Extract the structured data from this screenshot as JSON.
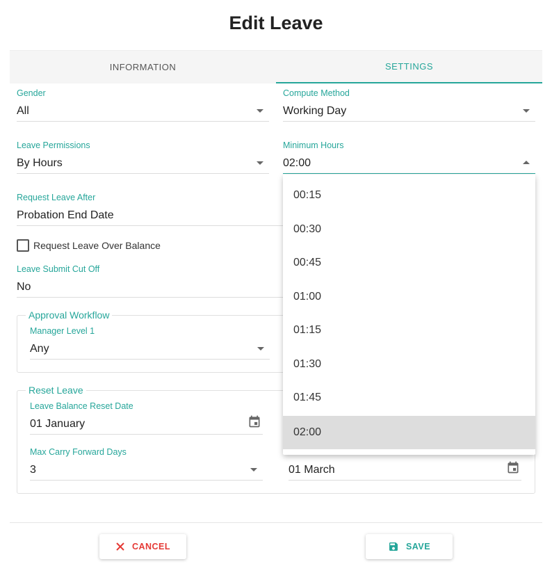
{
  "dialog": {
    "title": "Edit Leave"
  },
  "tabs": [
    {
      "label": "INFORMATION",
      "active": false
    },
    {
      "label": "SETTINGS",
      "active": true
    }
  ],
  "form": {
    "gender": {
      "label": "Gender",
      "value": "All"
    },
    "compute_method": {
      "label": "Compute Method",
      "value": "Working Day"
    },
    "leave_permissions": {
      "label": "Leave Permissions",
      "value": "By Hours"
    },
    "minimum_hours": {
      "label": "Minimum Hours",
      "value": "02:00"
    },
    "request_leave_after": {
      "label": "Request Leave After",
      "value": "Probation End Date"
    },
    "over_balance": {
      "label": "Request Leave Over Balance",
      "checked": false
    },
    "submit_cut_off": {
      "label": "Leave Submit Cut Off",
      "value": "No"
    }
  },
  "approval_workflow": {
    "legend": "Approval Workflow",
    "manager_level_1": {
      "label": "Manager Level 1",
      "value": "Any"
    }
  },
  "reset_leave": {
    "legend": "Reset Leave",
    "reset_date": {
      "label": "Leave Balance Reset Date",
      "value": "01 January"
    },
    "max_carry_forward": {
      "label": "Max Carry Forward Days",
      "value": "3"
    },
    "expiry_date": {
      "value": "01 March"
    }
  },
  "minimum_hours_options": {
    "items": [
      "00:15",
      "00:30",
      "00:45",
      "01:00",
      "01:15",
      "01:30",
      "01:45",
      "02:00"
    ],
    "selected": "02:00"
  },
  "actions": {
    "cancel_label": "CANCEL",
    "save_label": "SAVE"
  },
  "colors": {
    "accent": "#26a69a",
    "danger": "#e53935",
    "selected_option_bg": "#dddddd"
  }
}
